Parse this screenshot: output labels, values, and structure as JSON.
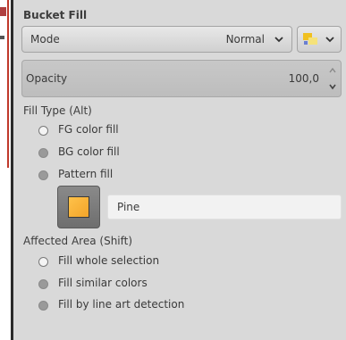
{
  "panel": {
    "title": "Bucket Fill"
  },
  "mode": {
    "label": "Mode",
    "value": "Normal"
  },
  "opacity": {
    "label": "Opacity",
    "value": "100,0"
  },
  "fill_type": {
    "label": "Fill Type  (Alt)",
    "options": [
      {
        "label": "FG color fill",
        "selected": true
      },
      {
        "label": "BG color fill",
        "selected": false
      },
      {
        "label": "Pattern fill",
        "selected": false
      }
    ]
  },
  "pattern": {
    "name": "Pine",
    "swatch_color": "#f8b43a"
  },
  "affected_area": {
    "label": "Affected Area  (Shift)",
    "options": [
      {
        "label": "Fill whole selection",
        "selected": true
      },
      {
        "label": "Fill similar colors",
        "selected": false
      },
      {
        "label": "Fill by line art detection",
        "selected": false
      }
    ]
  },
  "icons": {
    "mode_dropdown": "chevron-down-icon",
    "swatch_dropdown": "chevron-down-icon",
    "swatch": "color-swatch-icon",
    "spin_up": "chevron-up-icon",
    "spin_down": "chevron-down-icon"
  }
}
